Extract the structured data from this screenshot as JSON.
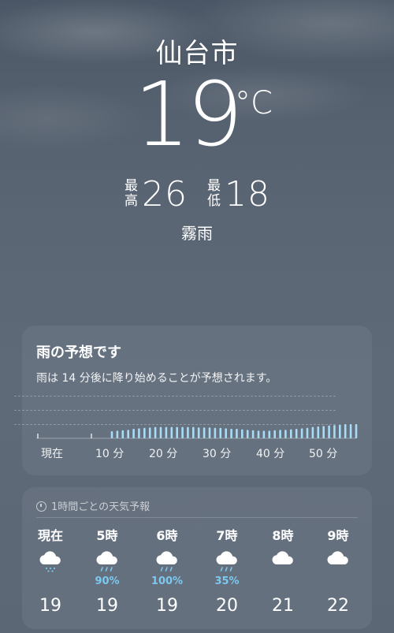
{
  "current": {
    "city": "仙台市",
    "temp": "19",
    "unit": "°C",
    "high_label": "最高",
    "high": "26",
    "low_label": "最低",
    "low": "18",
    "condition": "霧雨"
  },
  "rain_card": {
    "title": "雨の予想です",
    "description": "雨は 14 分後に降り始めることが予想されます。",
    "axis_labels": [
      "現在",
      "10 分",
      "20 分",
      "30 分",
      "40 分",
      "50 分"
    ],
    "bar_color": "#a8dcf5",
    "intensity": [
      0.3,
      0.32,
      0.34,
      0.36,
      0.4,
      0.42,
      0.44,
      0.46,
      0.48,
      0.48,
      0.48,
      0.48,
      0.48,
      0.48,
      0.48,
      0.48,
      0.46,
      0.46,
      0.46,
      0.44,
      0.44,
      0.42,
      0.4,
      0.4,
      0.38,
      0.36,
      0.34,
      0.32,
      0.32,
      0.32,
      0.34,
      0.36,
      0.36,
      0.38,
      0.4,
      0.42,
      0.44,
      0.48,
      0.5,
      0.52,
      0.54,
      0.56,
      0.58,
      0.6,
      0.6,
      0.6
    ]
  },
  "hourly": {
    "header": "1時間ごとの天気予報",
    "items": [
      {
        "time": "現在",
        "icon": "drizzle-cloud-icon",
        "precip": "",
        "temp": "19"
      },
      {
        "time": "5時",
        "icon": "rain-cloud-icon",
        "precip": "90%",
        "temp": "19"
      },
      {
        "time": "6時",
        "icon": "rain-cloud-icon",
        "precip": "100%",
        "temp": "19"
      },
      {
        "time": "7時",
        "icon": "rain-cloud-icon",
        "precip": "35%",
        "temp": "20"
      },
      {
        "time": "8時",
        "icon": "cloud-icon",
        "precip": "",
        "temp": "21"
      },
      {
        "time": "9時",
        "icon": "cloud-icon",
        "precip": "",
        "temp": "22"
      }
    ]
  }
}
